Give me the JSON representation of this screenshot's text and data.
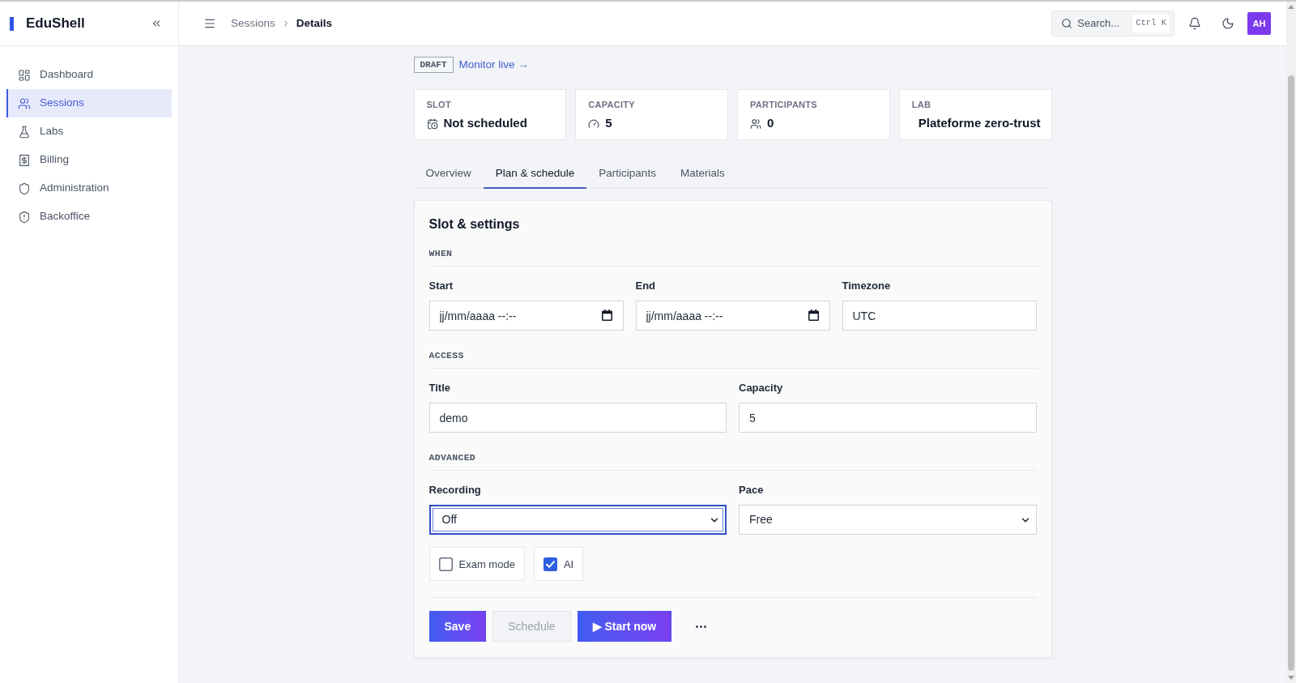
{
  "sidebar": {
    "brand": "EduShell",
    "items": [
      {
        "label": "Dashboard",
        "selected": false
      },
      {
        "label": "Sessions",
        "selected": true
      },
      {
        "label": "Labs",
        "selected": false
      },
      {
        "label": "Billing",
        "selected": false
      },
      {
        "label": "Administration",
        "selected": false
      },
      {
        "label": "Backoffice",
        "selected": false
      }
    ]
  },
  "topbar": {
    "breadcrumb": [
      "Sessions",
      "Details"
    ],
    "search": {
      "placeholder": "Search...",
      "shortcut": "Ctrl K"
    },
    "avatar": "AH"
  },
  "session": {
    "status": "DRAFT",
    "link": "Monitor live →"
  },
  "stats": [
    {
      "label": "SLOT",
      "value": "Not scheduled"
    },
    {
      "label": "CAPACITY",
      "value": "5"
    },
    {
      "label": "PARTICIPANTS",
      "value": "0"
    },
    {
      "label": "LAB",
      "value": "Plateforme zero-trust"
    }
  ],
  "tabs": [
    {
      "label": "Overview",
      "selected": false
    },
    {
      "label": "Plan & schedule",
      "selected": true
    },
    {
      "label": "Participants",
      "selected": false
    },
    {
      "label": "Materials",
      "selected": false
    }
  ],
  "form": {
    "title": "Slot & settings",
    "sections": [
      {
        "heading": "WHEN",
        "fields": [
          {
            "label": "Start",
            "kind": "datetime",
            "placeholder": "jj/mm/aaaa --:--",
            "focused": false
          },
          {
            "label": "End",
            "kind": "datetime",
            "placeholder": "jj/mm/aaaa --:--",
            "focused": false
          },
          {
            "label": "Timezone",
            "kind": "text",
            "value": "UTC",
            "focused": false
          }
        ]
      },
      {
        "heading": "ACCESS",
        "fields": [
          {
            "label": "Title",
            "kind": "text",
            "value": "demo",
            "focused": false
          },
          {
            "label": "Capacity",
            "kind": "text",
            "value": "5",
            "focused": false
          }
        ]
      },
      {
        "heading": "ADVANCED",
        "fields": [
          {
            "label": "Recording",
            "kind": "select",
            "value": "Off",
            "focused": true
          },
          {
            "label": "Pace",
            "kind": "select",
            "value": "Free",
            "focused": false
          }
        ],
        "options": [
          {
            "label": "Exam mode",
            "checked": false
          },
          {
            "label": "AI",
            "checked": true
          }
        ]
      }
    ],
    "actions": [
      {
        "label": "Save",
        "kind": "primary",
        "disabled": false
      },
      {
        "label": "Schedule",
        "kind": "secondary",
        "disabled": true
      },
      {
        "label": "▶ Start now",
        "kind": "primary",
        "disabled": false
      }
    ]
  }
}
